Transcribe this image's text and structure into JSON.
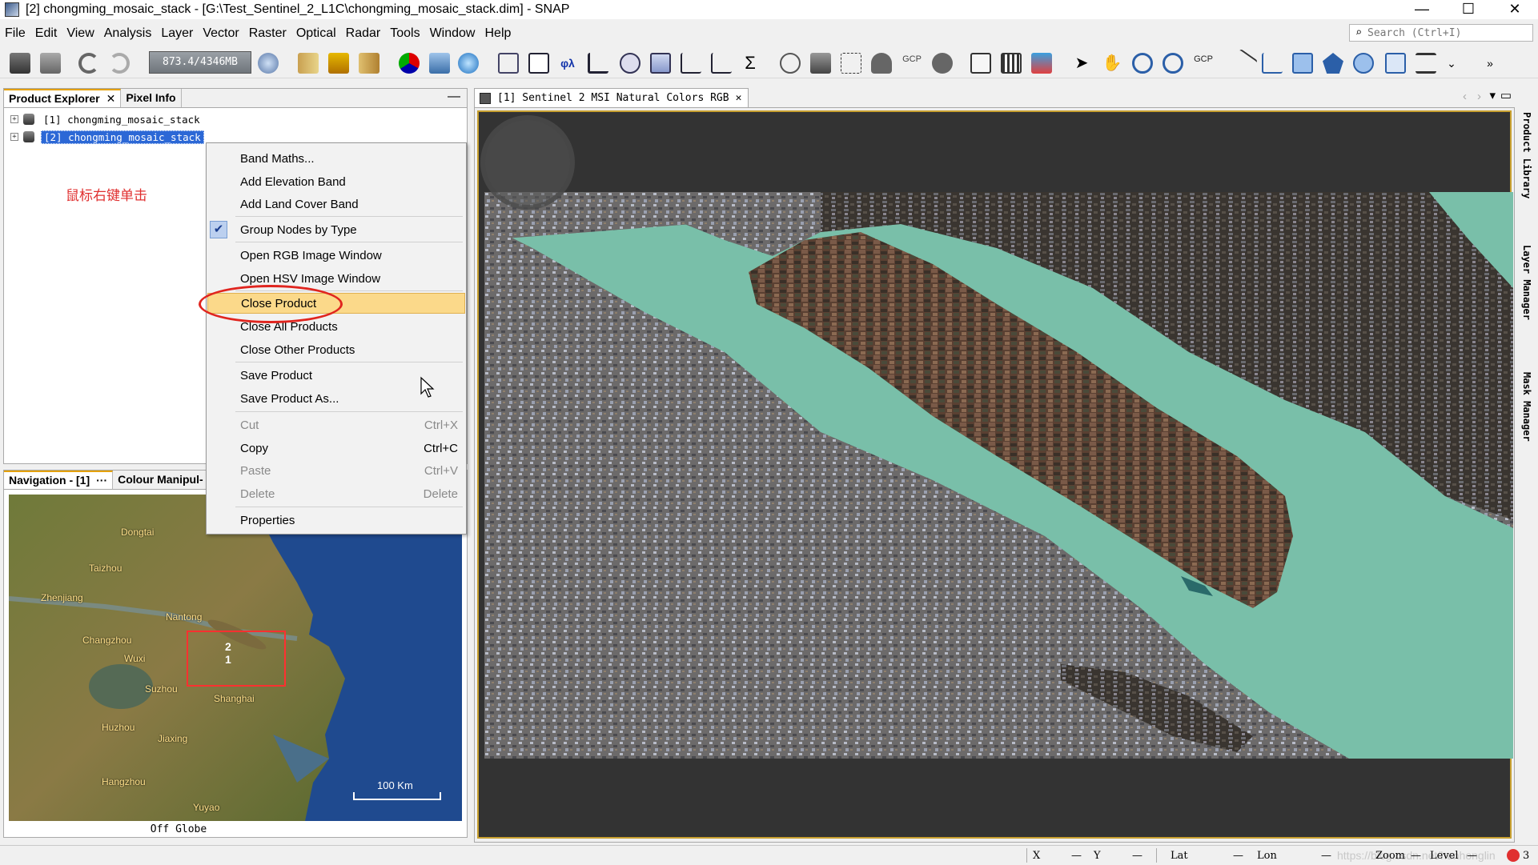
{
  "window": {
    "title": "[2] chongming_mosaic_stack - [G:\\Test_Sentinel_2_L1C\\chongming_mosaic_stack.dim] - SNAP",
    "min": "—",
    "max": "☐",
    "close": "✕"
  },
  "menu": [
    "File",
    "Edit",
    "View",
    "Analysis",
    "Layer",
    "Vector",
    "Raster",
    "Optical",
    "Radar",
    "Tools",
    "Window",
    "Help"
  ],
  "search": {
    "placeholder": "Search (Ctrl+I)"
  },
  "toolbar": {
    "memory": "873.4/4346MB"
  },
  "product_explorer": {
    "tabs": [
      {
        "label": "Product Explorer",
        "close": "✕"
      },
      {
        "label": "Pixel Info"
      }
    ],
    "minimize": "—",
    "products": [
      {
        "label": "[1] chongming_mosaic_stack",
        "expander": "+"
      },
      {
        "label": "[2] chongming_mosaic_stack",
        "expander": "+"
      }
    ],
    "annotation": "鼠标右键单击"
  },
  "context_menu": {
    "items": [
      {
        "label": "Band Maths...",
        "shortcut": ""
      },
      {
        "label": "Add Elevation Band",
        "shortcut": ""
      },
      {
        "label": "Add Land Cover Band",
        "shortcut": ""
      },
      {
        "label": "Group Nodes by Type",
        "shortcut": "",
        "checked": true
      },
      {
        "label": "Open RGB Image Window",
        "shortcut": ""
      },
      {
        "label": "Open HSV Image Window",
        "shortcut": ""
      },
      {
        "label": "Close Product",
        "shortcut": "",
        "highlighted": true
      },
      {
        "label": "Close All Products",
        "shortcut": ""
      },
      {
        "label": "Close Other Products",
        "shortcut": ""
      },
      {
        "label": "Save Product",
        "shortcut": ""
      },
      {
        "label": "Save Product As...",
        "shortcut": ""
      },
      {
        "label": "Cut",
        "shortcut": "Ctrl+X",
        "disabled": true
      },
      {
        "label": "Copy",
        "shortcut": "Ctrl+C"
      },
      {
        "label": "Paste",
        "shortcut": "Ctrl+V",
        "disabled": true
      },
      {
        "label": "Delete",
        "shortcut": "Delete",
        "disabled": true
      },
      {
        "label": "Properties",
        "shortcut": ""
      }
    ],
    "check_glyph": "✔"
  },
  "navigation": {
    "tabs": [
      {
        "label": "Navigation - [1]",
        "extra": "···"
      },
      {
        "label": "Colour Manipul-"
      }
    ],
    "map_labels": [
      "Dongtai",
      "Taizhou",
      "Zhenjiang",
      "Nantong",
      "Changzhou",
      "Wuxi",
      "Suzhou",
      "Shanghai",
      "Huzhou",
      "Jiaxing",
      "Hangzhou",
      "Yuyao"
    ],
    "box_labels": [
      "2",
      "1"
    ],
    "scale": "100 Km",
    "footer": "Off Globe"
  },
  "image_view": {
    "tab_label": "[1] Sentinel 2 MSI Natural Colors RGB",
    "tab_close": "✕"
  },
  "right_panels": [
    "Product Library",
    "Layer Manager",
    "Mask Manager"
  ],
  "status": {
    "x_label": "X",
    "x_value": "—",
    "y_label": "Y",
    "y_value": "—",
    "lat_label": "Lat",
    "lat_value": "—",
    "lon_label": "Lon",
    "lon_value": "—",
    "zoom_label": "Zoom",
    "zoom_value": "—",
    "level_label": "Level",
    "level_value": "—",
    "watermark": "https://blog.csdn.net/hunhonglin",
    "notifications": "3"
  },
  "colors": {
    "accent": "#e5a100",
    "selection": "#2c68d6",
    "highlight": "#fbd98a",
    "annotation": "#e0251f"
  }
}
